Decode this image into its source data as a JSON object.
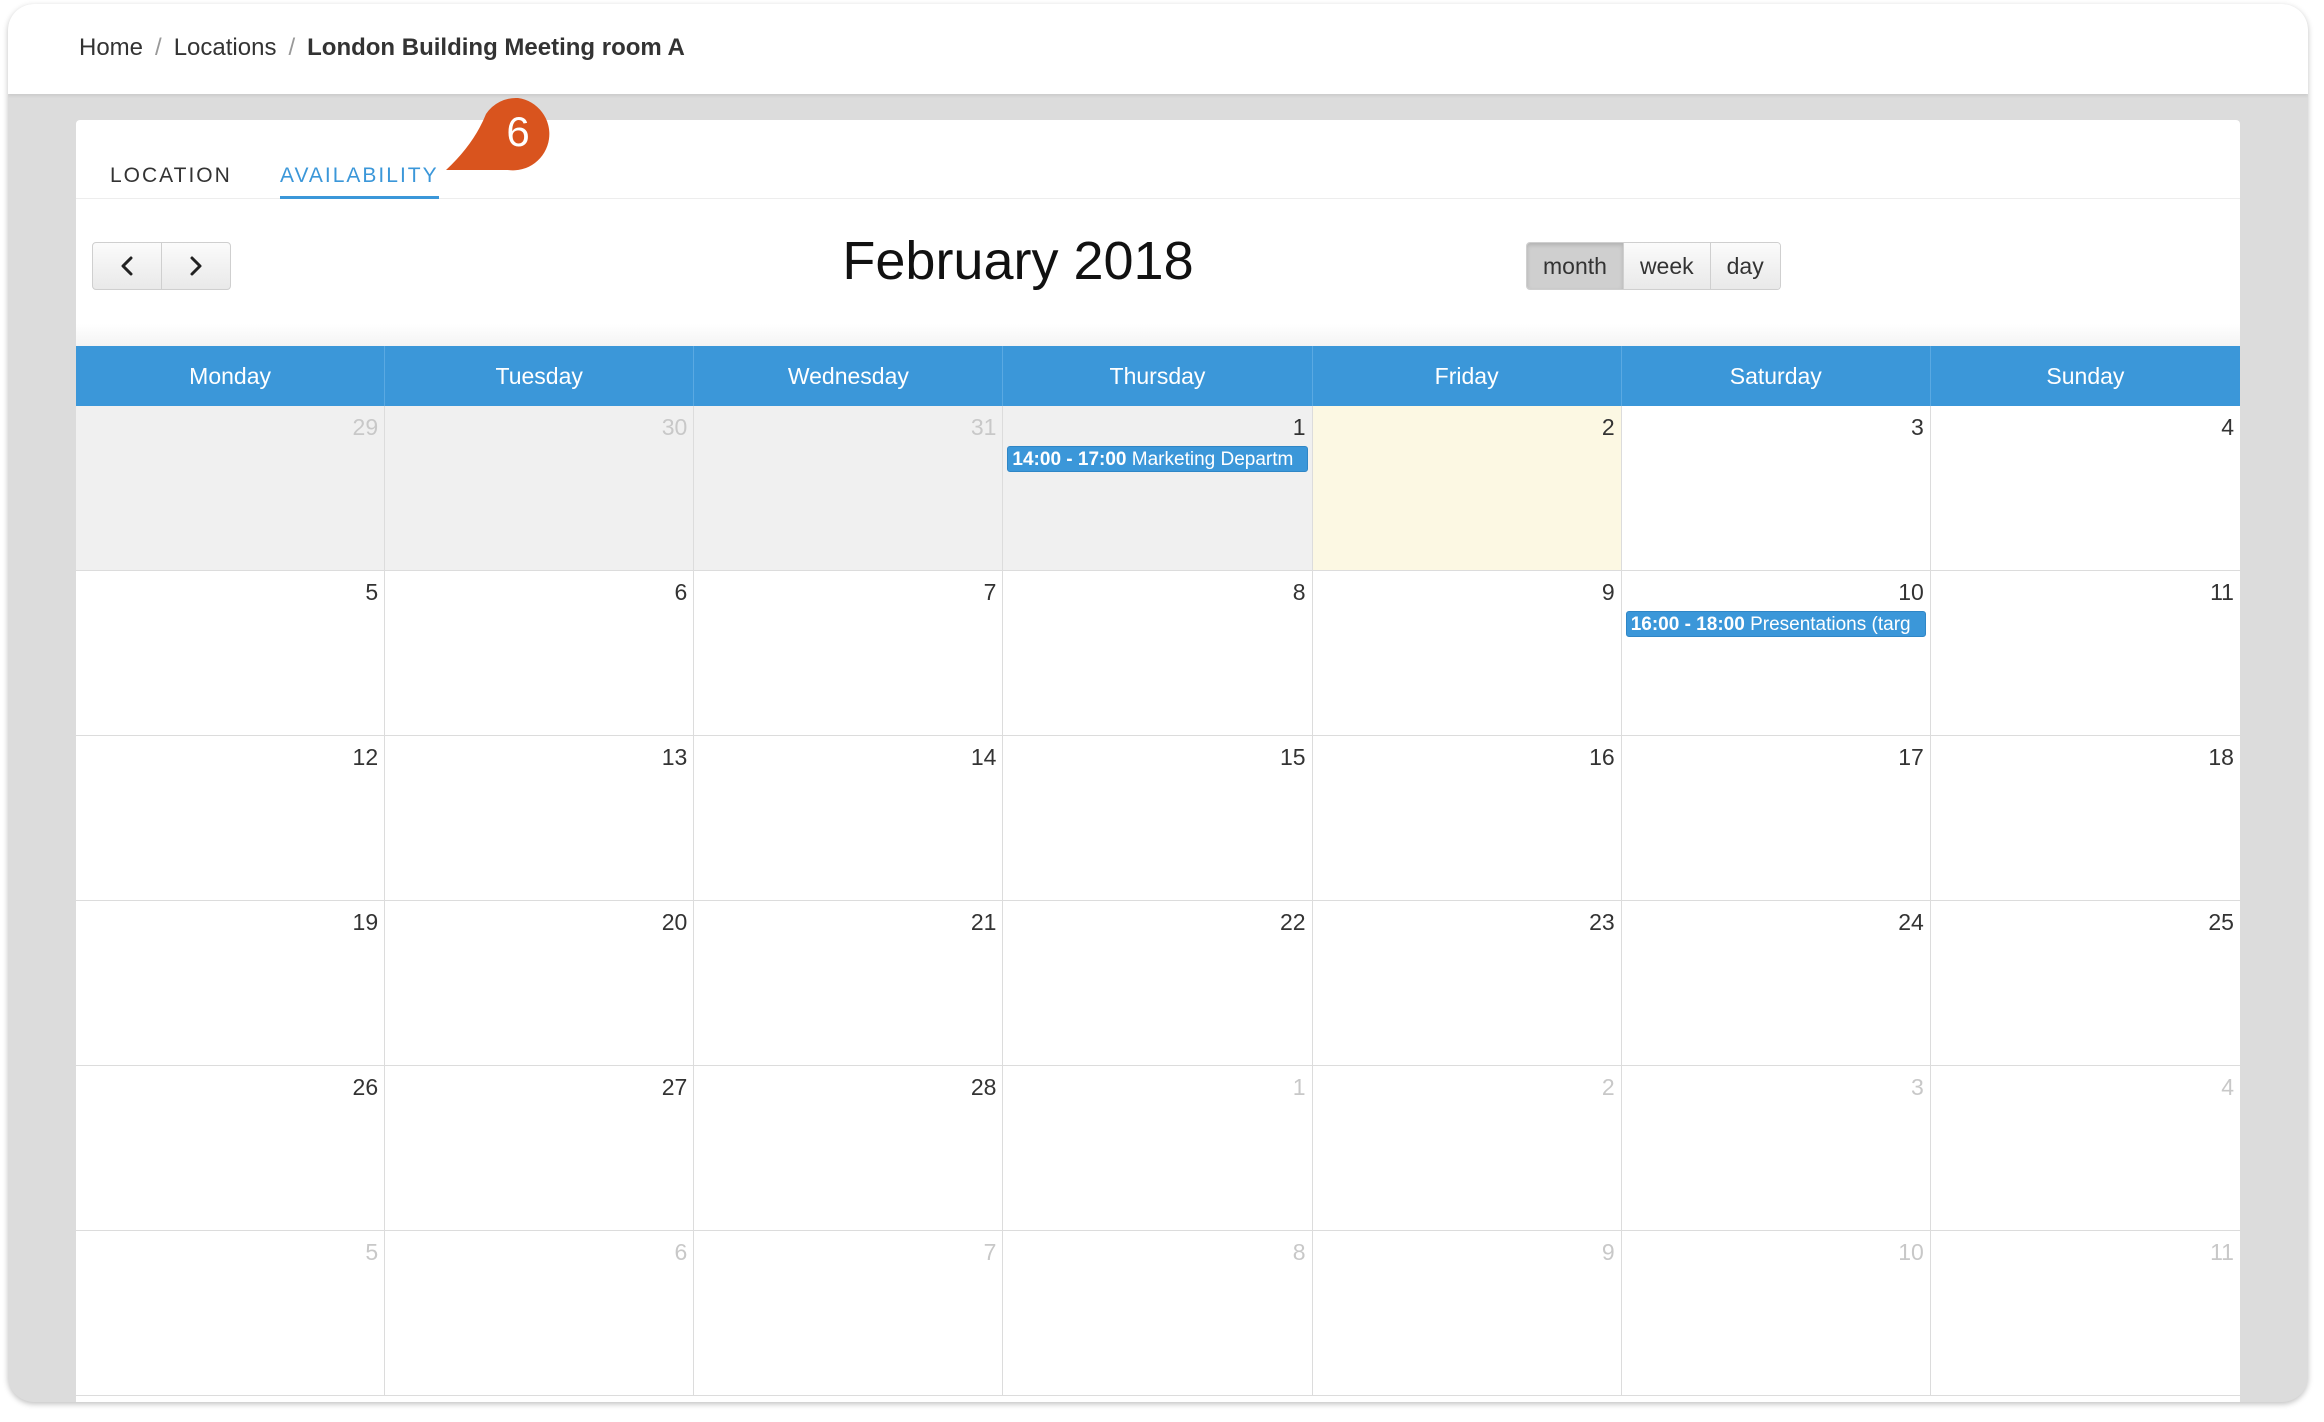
{
  "breadcrumb": {
    "home": "Home",
    "locations": "Locations",
    "current": "London Building Meeting room A",
    "separator": "/"
  },
  "tabs": {
    "location": "LOCATION",
    "availability": "AVAILABILITY",
    "active": "availability"
  },
  "badge": {
    "label": "6",
    "color": "#d9541e"
  },
  "calendar": {
    "title": "February 2018",
    "nav": {
      "prev": "chevron-left-icon",
      "next": "chevron-right-icon"
    },
    "views": {
      "month": "month",
      "week": "week",
      "day": "day",
      "active": "month"
    },
    "weekdays": [
      "Monday",
      "Tuesday",
      "Wednesday",
      "Thursday",
      "Friday",
      "Saturday",
      "Sunday"
    ],
    "weeks": [
      [
        {
          "n": "29",
          "other": true,
          "past": true
        },
        {
          "n": "30",
          "other": true,
          "past": true
        },
        {
          "n": "31",
          "other": true,
          "past": true
        },
        {
          "n": "1",
          "past": true,
          "event": {
            "time": "14:00 - 17:00",
            "title": "Marketing Departm"
          }
        },
        {
          "n": "2",
          "today": true
        },
        {
          "n": "3"
        },
        {
          "n": "4"
        }
      ],
      [
        {
          "n": "5"
        },
        {
          "n": "6"
        },
        {
          "n": "7"
        },
        {
          "n": "8"
        },
        {
          "n": "9"
        },
        {
          "n": "10",
          "event": {
            "time": "16:00 - 18:00",
            "title": "Presentations (targ"
          }
        },
        {
          "n": "11"
        }
      ],
      [
        {
          "n": "12"
        },
        {
          "n": "13"
        },
        {
          "n": "14"
        },
        {
          "n": "15"
        },
        {
          "n": "16"
        },
        {
          "n": "17"
        },
        {
          "n": "18"
        }
      ],
      [
        {
          "n": "19"
        },
        {
          "n": "20"
        },
        {
          "n": "21"
        },
        {
          "n": "22"
        },
        {
          "n": "23"
        },
        {
          "n": "24"
        },
        {
          "n": "25"
        }
      ],
      [
        {
          "n": "26"
        },
        {
          "n": "27"
        },
        {
          "n": "28"
        },
        {
          "n": "1",
          "other": true
        },
        {
          "n": "2",
          "other": true
        },
        {
          "n": "3",
          "other": true
        },
        {
          "n": "4",
          "other": true
        }
      ],
      [
        {
          "n": "5",
          "other": true
        },
        {
          "n": "6",
          "other": true
        },
        {
          "n": "7",
          "other": true
        },
        {
          "n": "8",
          "other": true
        },
        {
          "n": "9",
          "other": true
        },
        {
          "n": "10",
          "other": true
        },
        {
          "n": "11",
          "other": true
        }
      ]
    ]
  },
  "colors": {
    "header_blue": "#3b97d9",
    "today_bg": "#fcf8e3",
    "past_bg": "#f0f0f0"
  }
}
